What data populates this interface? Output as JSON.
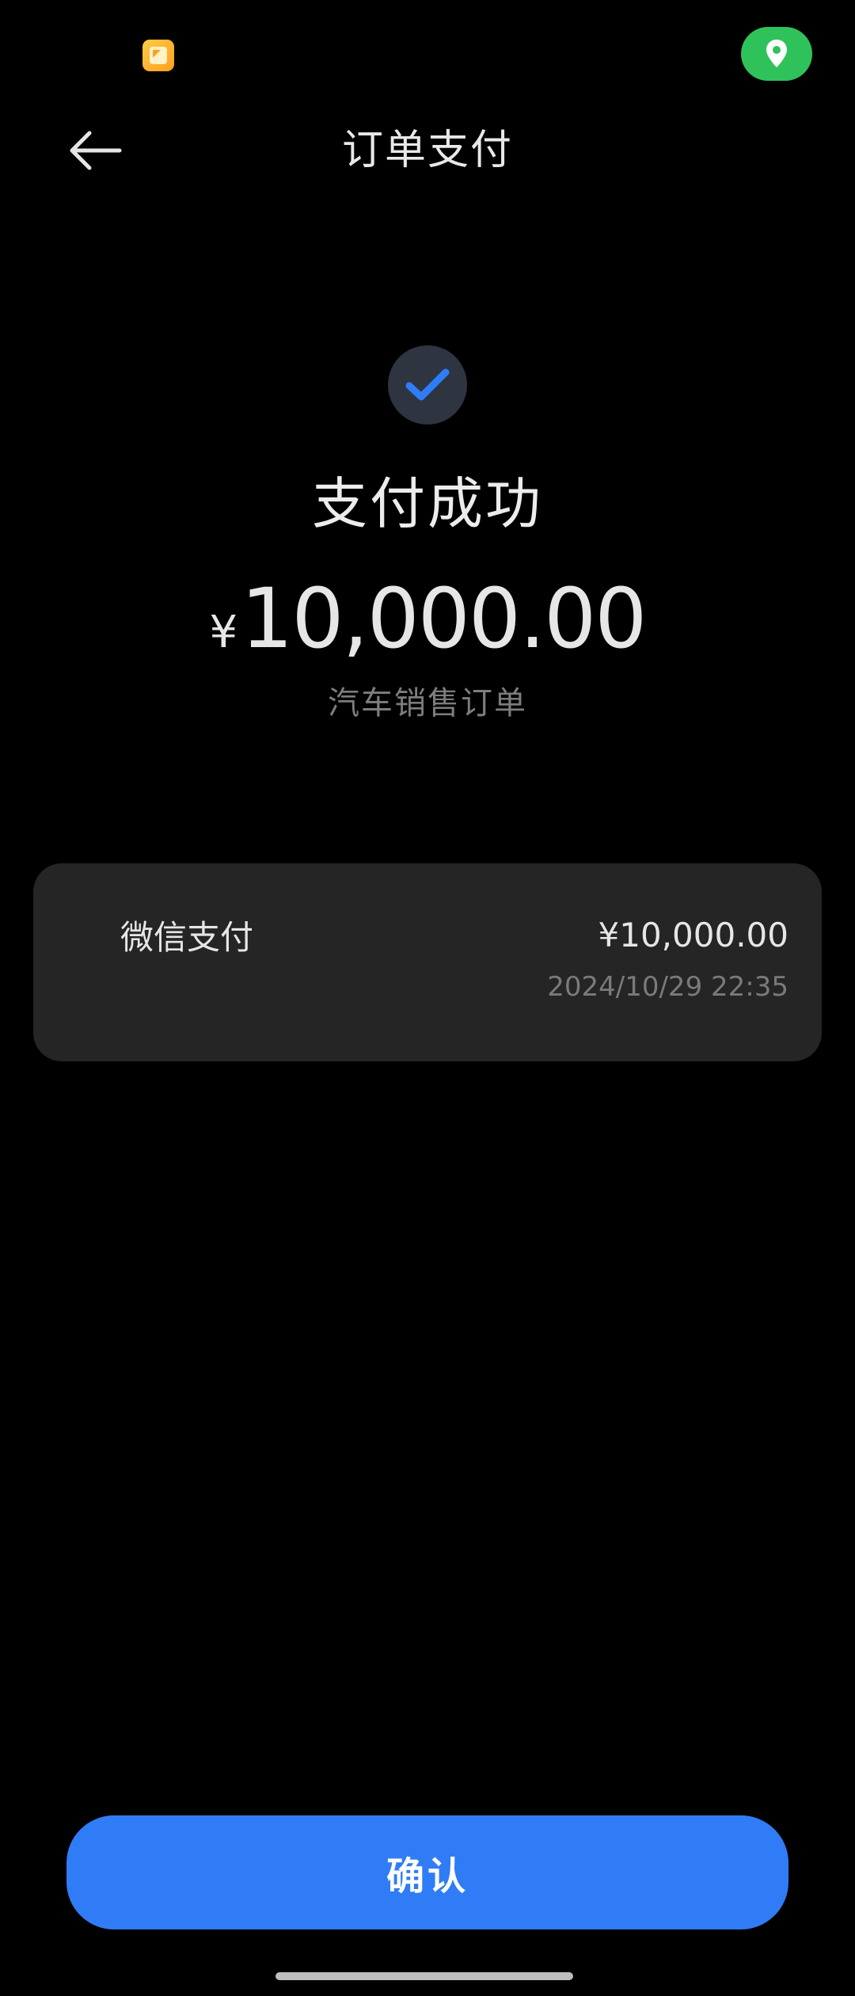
{
  "status_bar": {
    "notification_icon": "gallery-notification-icon",
    "location_icon": "location-pin-icon",
    "location_color": "#2fc25b"
  },
  "header": {
    "back_icon": "arrow-left-icon",
    "title": "订单支付"
  },
  "result": {
    "icon": "check-icon",
    "icon_color": "#2f7cf6",
    "title": "支付成功",
    "currency_symbol": "¥",
    "amount": "10,000.00",
    "order_type": "汽车销售订单"
  },
  "payment_detail": {
    "method": "微信支付",
    "amount": "¥10,000.00",
    "time": "2024/10/29 22:35"
  },
  "footer": {
    "confirm_label": "确认",
    "button_color": "#2f7cf6"
  }
}
